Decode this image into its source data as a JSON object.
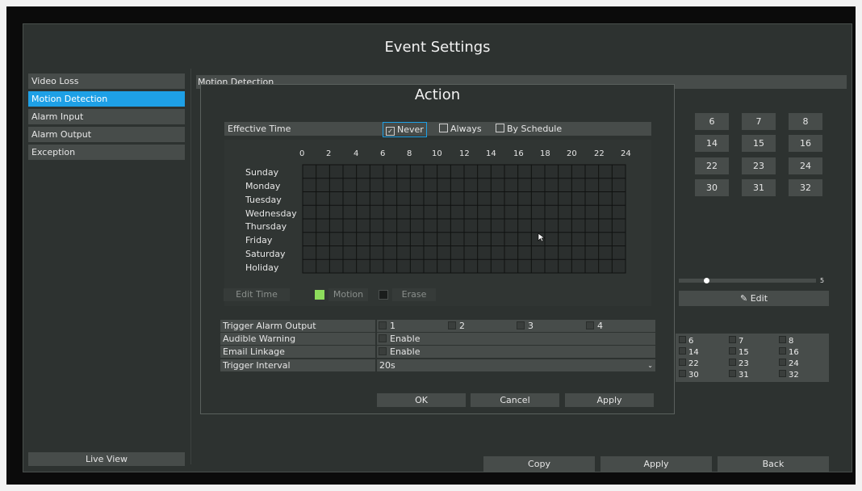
{
  "window": {
    "title": "Event Settings"
  },
  "sidebar": {
    "items": [
      {
        "label": "Video Loss",
        "active": false
      },
      {
        "label": "Motion Detection",
        "active": true
      },
      {
        "label": "Alarm Input",
        "active": false
      },
      {
        "label": "Alarm Output",
        "active": false
      },
      {
        "label": "Exception",
        "active": false
      }
    ],
    "live_view_label": "Live View"
  },
  "main": {
    "section_title": "Motion Detection",
    "channel_buttons": [
      "6",
      "7",
      "8",
      "14",
      "15",
      "16",
      "22",
      "23",
      "24",
      "30",
      "31",
      "32"
    ],
    "sensitivity_value": "5",
    "sensitivity_level": 0.22,
    "edit_label": "Edit",
    "channel_checkboxes": [
      "6",
      "7",
      "8",
      "14",
      "15",
      "16",
      "22",
      "23",
      "24",
      "30",
      "31",
      "32"
    ]
  },
  "footer": {
    "copy_label": "Copy",
    "apply_label": "Apply",
    "back_label": "Back"
  },
  "modal": {
    "title": "Action",
    "effective_time": {
      "label": "Effective Time",
      "options": [
        {
          "label": "Never",
          "checked": true
        },
        {
          "label": "Always",
          "checked": false
        },
        {
          "label": "By Schedule",
          "checked": false
        }
      ]
    },
    "schedule": {
      "hours": [
        "0",
        "2",
        "4",
        "6",
        "8",
        "10",
        "12",
        "14",
        "16",
        "18",
        "20",
        "22",
        "24"
      ],
      "days": [
        "Sunday",
        "Monday",
        "Tuesday",
        "Wednesday",
        "Thursday",
        "Friday",
        "Saturday",
        "Holiday"
      ]
    },
    "tools": {
      "edit_time": "Edit Time",
      "motion": "Motion",
      "erase": "Erase"
    },
    "fields": {
      "trigger_alarm_output": {
        "label": "Trigger Alarm Output",
        "options": [
          "1",
          "2",
          "3",
          "4"
        ]
      },
      "audible_warning": {
        "label": "Audible Warning",
        "value": "Enable"
      },
      "email_linkage": {
        "label": "Email Linkage",
        "value": "Enable"
      },
      "trigger_interval": {
        "label": "Trigger Interval",
        "value": "20s"
      }
    },
    "buttons": {
      "ok": "OK",
      "cancel": "Cancel",
      "apply": "Apply"
    }
  },
  "colors": {
    "accent": "#1ea0e6",
    "panel": "#2d3230",
    "control": "#474c4a",
    "motion_swatch": "#8ddc5c"
  },
  "icons": {
    "checkbox_checked": "check-icon",
    "edit": "edit-icon",
    "cursor": "mouse-cursor-icon",
    "dropdown": "chevron-down-icon"
  }
}
